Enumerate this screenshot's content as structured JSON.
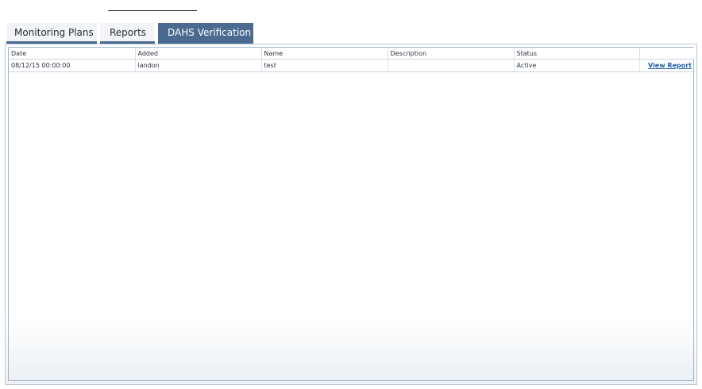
{
  "tabs": [
    {
      "label": "Monitoring Plans",
      "active": false
    },
    {
      "label": "Reports",
      "active": false
    },
    {
      "label": "DAHS Verification",
      "active": true
    }
  ],
  "grid": {
    "columns": [
      "Date",
      "Added",
      "Name",
      "Description",
      "Status",
      ""
    ],
    "rows": [
      {
        "date": "08/12/15 00:00:00",
        "added": "landon",
        "name": "test",
        "description": "",
        "status": "Active",
        "action": "View Report"
      }
    ]
  },
  "colors": {
    "accent": "#4a6b8f",
    "link": "#1f5ea8",
    "border": "#9fb2c6"
  }
}
